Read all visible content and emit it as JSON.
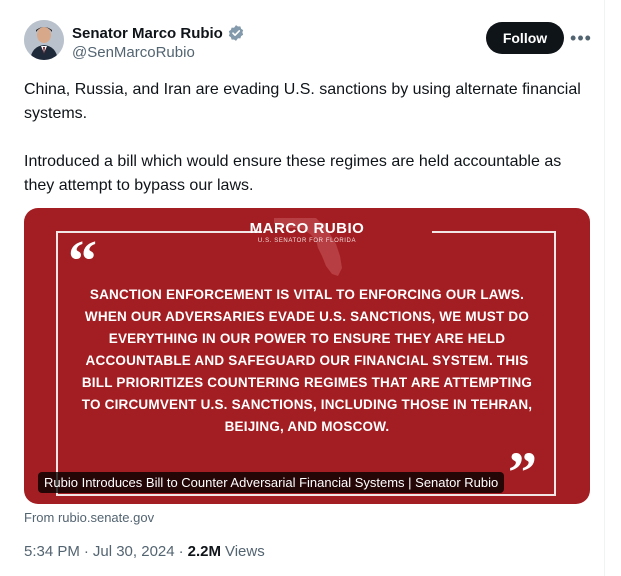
{
  "author": {
    "name": "Senator Marco Rubio",
    "handle": "@SenMarcoRubio",
    "verified_color": "#829aab"
  },
  "actions": {
    "follow_label": "Follow",
    "more_label": "•••"
  },
  "tweet": {
    "paragraphs": [
      "China, Russia, and Iran are evading U.S. sanctions by using alternate financial systems.",
      "Introduced a bill which would ensure these regimes are held accountable as they attempt to bypass our laws."
    ]
  },
  "card": {
    "brand_name": "MARCO RUBIO",
    "brand_subtitle": "U.S. SENATOR FOR FLORIDA",
    "quote_open": "“",
    "quote_close": "”",
    "quote_text": "SANCTION ENFORCEMENT IS VITAL TO ENFORCING OUR LAWS. WHEN OUR ADVERSARIES EVADE U.S. SANCTIONS, WE MUST DO EVERYTHING IN OUR POWER TO ENSURE THEY ARE HELD ACCOUNTABLE AND SAFEGUARD OUR FINANCIAL SYSTEM. THIS BILL PRIORITIZES COUNTERING REGIMES THAT ARE ATTEMPTING TO CIRCUMVENT U.S. SANCTIONS, INCLUDING THOSE IN TEHRAN, BEIJING, AND MOSCOW.",
    "caption": "Rubio Introduces Bill to Counter Adversarial Financial Systems | Senator Rubio",
    "background_color": "#a31e22"
  },
  "source": {
    "from_text": "From rubio.senate.gov"
  },
  "meta": {
    "time": "5:34 PM",
    "separator": "·",
    "date": "Jul 30, 2024",
    "separator2": "·",
    "views_count": "2.2M",
    "views_label": "Views"
  }
}
